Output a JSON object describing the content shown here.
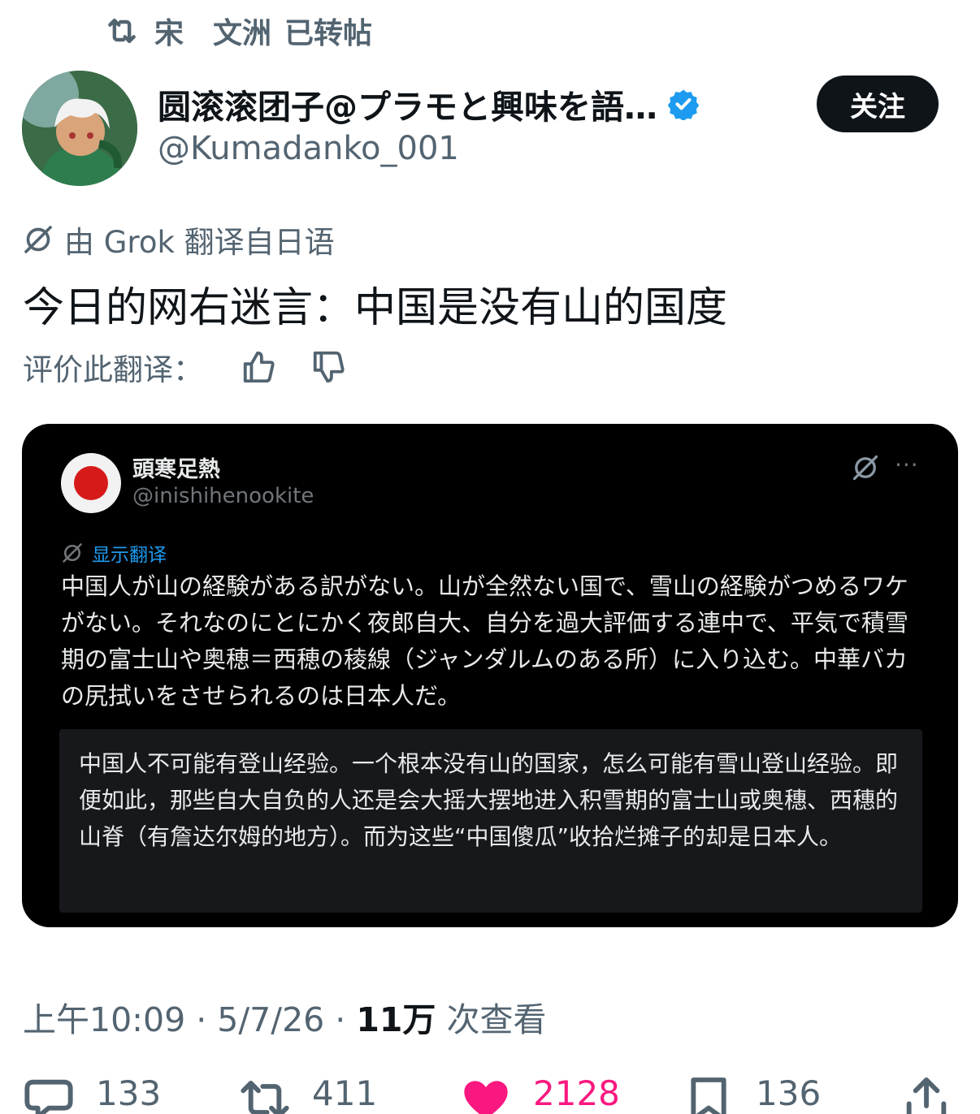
{
  "repost_header": {
    "icon": "repost-icon",
    "user": "宋　文洲",
    "label": "已转帖"
  },
  "author": {
    "display_name": "圆滚滚团子@プラモと興味を語…",
    "handle": "@Kumadanko_001",
    "verified_badge_color": "#1d9bf0",
    "follow_label": "关注"
  },
  "translation": {
    "note": "由 Grok 翻译自日语",
    "text": "今日的网右迷言：中国是没有山的国度",
    "rate_label": "评价此翻译："
  },
  "quoted": {
    "name": "頭寒足熱",
    "handle": "@inishihenookite",
    "more": "···",
    "show_translation": "显示翻译",
    "original_text": "中国人が山の経験がある訳がない。山が全然ない国で、雪山の経験がつめるワケがない。それなのにとにかく夜郎自大、自分を過大評価する連中で、平気で積雪期の富士山や奥穂＝西穂の稜線（ジャンダルムのある所）に入り込む。中華バカの尻拭いをさせられるのは日本人だ。",
    "translated_text": "中国人不可能有登山经验。一个根本没有山的国家，怎么可能有雪山登山经验。即便如此，那些自大自负的人还是会大摇大摆地进入积雪期的富士山或奥穗、西穗的山脊（有詹达尔姆的地方）。而为这些“中国傻瓜”收拾烂摊子的却是日本人。"
  },
  "meta": {
    "time": "上午10:09",
    "date": "5/7/26",
    "views_count": "11万",
    "views_label": "次查看"
  },
  "actions": {
    "replies": "133",
    "reposts": "411",
    "likes": "2128",
    "bookmarks": "136",
    "like_color": "#f91880"
  }
}
